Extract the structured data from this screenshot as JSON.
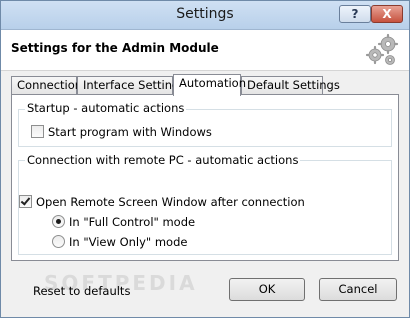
{
  "window": {
    "title": "Settings",
    "help_label": "?",
    "close_label": "X"
  },
  "header": {
    "title": "Settings for the Admin Module",
    "icon": "gears-icon"
  },
  "tabs": [
    {
      "label": "Connection",
      "active": false
    },
    {
      "label": "Interface Settings",
      "active": false
    },
    {
      "label": "Automation",
      "active": true
    },
    {
      "label": "Default Settings",
      "active": false
    }
  ],
  "startup": {
    "legend": "Startup - automatic actions",
    "start_with_windows": {
      "label": "Start program with Windows",
      "checked": false
    }
  },
  "remote": {
    "legend": "Connection with remote PC - automatic actions",
    "open_window": {
      "label": "Open Remote Screen Window after connection",
      "checked": true
    },
    "mode_options": [
      {
        "label": "In \"Full Control\" mode",
        "selected": true
      },
      {
        "label": "In \"View Only\" mode",
        "selected": false
      }
    ]
  },
  "watermark": "SOFTPEDIA",
  "footer": {
    "reset_label": "Reset to defaults",
    "ok_label": "OK",
    "cancel_label": "Cancel"
  }
}
